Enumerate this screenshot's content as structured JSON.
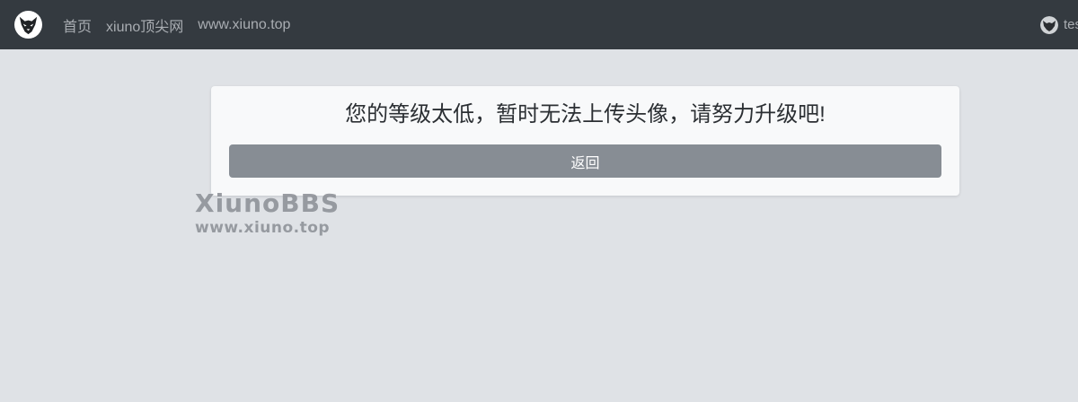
{
  "navbar": {
    "logo_icon": "wolf-head-logo-icon",
    "links": [
      {
        "label": "首页"
      },
      {
        "label": "xiuno顶尖网"
      },
      {
        "label": "www.xiuno.top"
      }
    ],
    "user": {
      "avatar_icon": "user-avatar-icon",
      "name": "test"
    },
    "background": "#343a40",
    "link_color": "#a9adb2"
  },
  "dialog": {
    "message": "您的等级太低，暂时无法上传头像，请努力升级吧!",
    "back_label": "返回",
    "button_color": "#878d94"
  },
  "watermark": {
    "title": "XiunoBBS",
    "url": "www.xiuno.top"
  },
  "page": {
    "background": "#dfe2e6"
  }
}
